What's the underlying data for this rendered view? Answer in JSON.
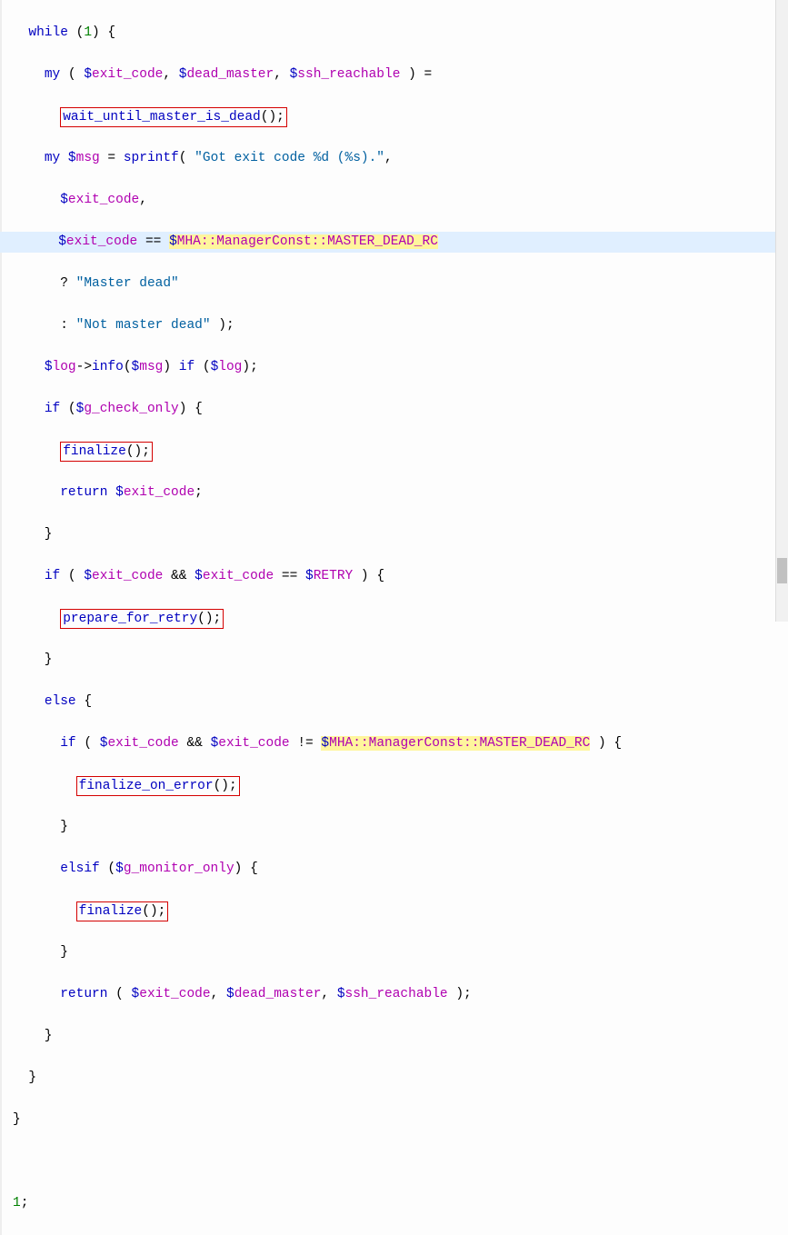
{
  "code": {
    "l1": {
      "kw": "while",
      "num": "1"
    },
    "l2": {
      "kw": "my",
      "v1": "exit_code",
      "v2": "dead_master",
      "v3": "ssh_reachable"
    },
    "l3": {
      "fn": "wait_until_master_is_dead"
    },
    "l4": {
      "kw": "my",
      "v": "msg",
      "fn": "sprintf",
      "str": "\"Got exit code %d (%s).\""
    },
    "l5": {
      "v": "exit_code"
    },
    "l6": {
      "v": "exit_code",
      "op": "==",
      "pkg": "MHA::ManagerConst::MASTER_DEAD_RC"
    },
    "l7": {
      "q": "?",
      "str": "\"Master dead\""
    },
    "l8": {
      "q": ":",
      "str": "\"Not master dead\""
    },
    "l9": {
      "v1": "log",
      "m": "info",
      "v2": "msg",
      "kw": "if",
      "v3": "log"
    },
    "l10": {
      "kw": "if",
      "v": "g_check_only"
    },
    "l11": {
      "fn": "finalize"
    },
    "l12": {
      "kw": "return",
      "v": "exit_code"
    },
    "l14": {
      "kw": "if",
      "v1": "exit_code",
      "op": "&&",
      "v2": "exit_code",
      "eq": "==",
      "v3": "RETRY"
    },
    "l15": {
      "fn": "prepare_for_retry"
    },
    "l17": {
      "kw": "else"
    },
    "l18": {
      "kw": "if",
      "v1": "exit_code",
      "op": "&&",
      "v2": "exit_code",
      "ne": "!=",
      "pkg": "MHA::ManagerConst::MASTER_DEAD_RC"
    },
    "l19": {
      "fn": "finalize_on_error"
    },
    "l21": {
      "kw": "elsif",
      "v": "g_monitor_only"
    },
    "l22": {
      "fn": "finalize"
    },
    "l24": {
      "kw": "return",
      "v1": "exit_code",
      "v2": "dead_master",
      "v3": "ssh_reachable"
    },
    "l29": {
      "num": "1"
    }
  }
}
